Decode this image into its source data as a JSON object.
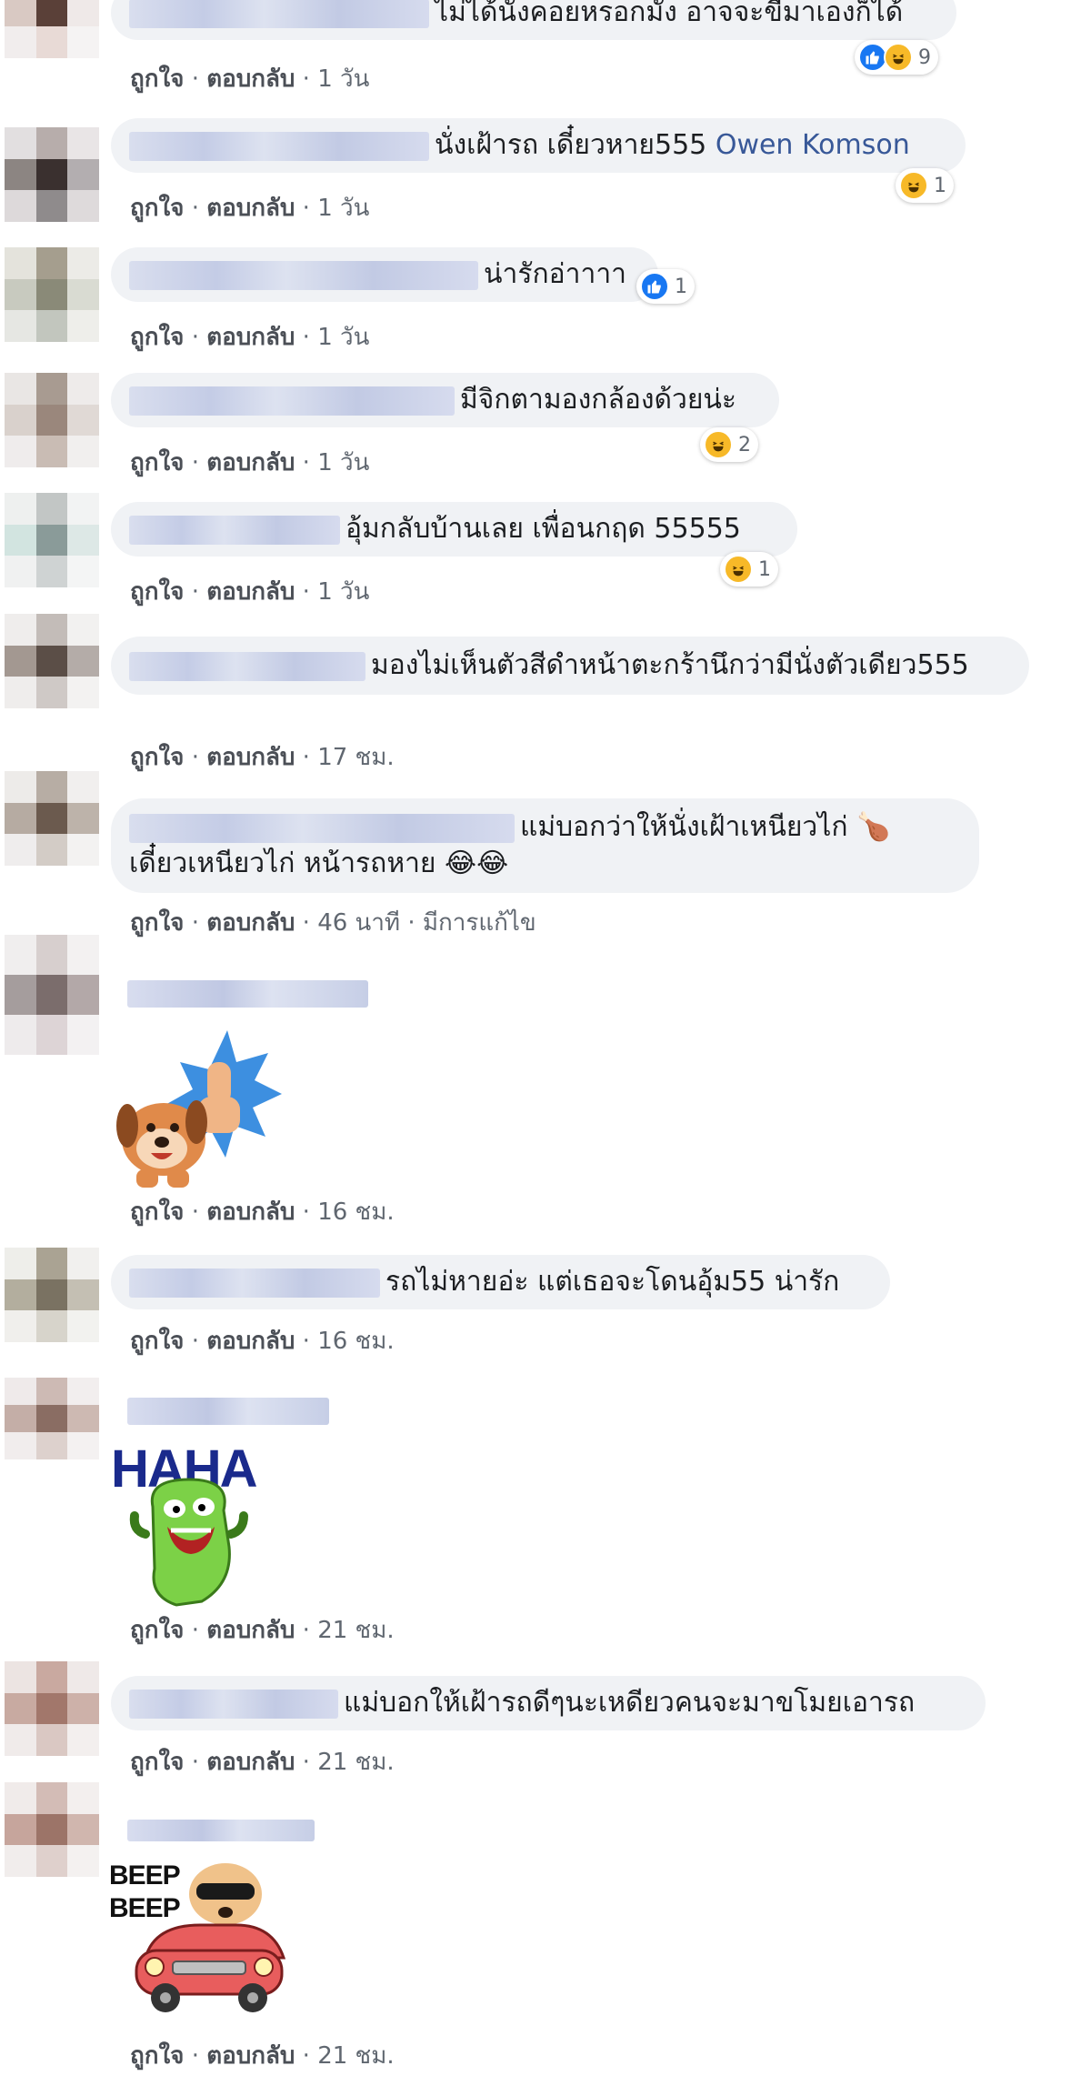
{
  "actions": {
    "like": "ถูกใจ",
    "reply": "ตอบกลับ",
    "dot": "·",
    "edited": "มีการแก้ไข"
  },
  "comments": [
    {
      "text": "ไม่ได้นั่งคอยหรอกมั้ง อาจจะขี่มาเองก็ได้",
      "time": "1 วัน",
      "reaction_count": "9"
    },
    {
      "text": "นั่งเฝ้ารถ เดี๋ยวหาย555",
      "mention": "Owen Komson",
      "time": "1 วัน",
      "reaction_count": "1"
    },
    {
      "text": "น่ารักอ่าาาา",
      "time": "1 วัน",
      "reaction_count": "1"
    },
    {
      "text": "มีจิกตามองกล้องด้วยน่ะ",
      "time": "1 วัน",
      "reaction_count": "2"
    },
    {
      "text": "อุ้มกลับบ้านเลย เพื่อนกฤด 55555",
      "time": "1 วัน",
      "reaction_count": "1"
    },
    {
      "text": "มองไม่เห็นตัวสีดำหน้าตะกร้านึกว่ามีนั่งตัวเดียว555",
      "time": "17 ชม."
    },
    {
      "text": "แม่บอกว่าให้นั่งเฝ้าเหนียวไก่ 🍗 เดี๋ยวเหนียวไก่ หน้ารถหาย 😂😂",
      "time": "46 นาที"
    },
    {
      "time": "16 ชม."
    },
    {
      "text": "รถไม่หายอ่ะ แต่เธอจะโดนอุ้ม55 น่ารัก",
      "time": "16 ชม."
    },
    {
      "sticker_text": "HAHA",
      "time": "21 ชม."
    },
    {
      "text": "แม่บอกให้เฝ้ารถดีๆนะเหดียวคนจะมาขโมยเอารถ",
      "time": "21 ชม."
    },
    {
      "sticker_text": "BEEP BEEP",
      "time": "21 ชม."
    }
  ],
  "icons": {
    "like": "thumbs-up-icon",
    "haha": "laughing-face-icon"
  },
  "colors": {
    "bubble": "#f0f2f5",
    "link": "#385898",
    "meta": "#606770",
    "like_blue": "#1877f2",
    "haha_yellow": "#f7b928"
  }
}
